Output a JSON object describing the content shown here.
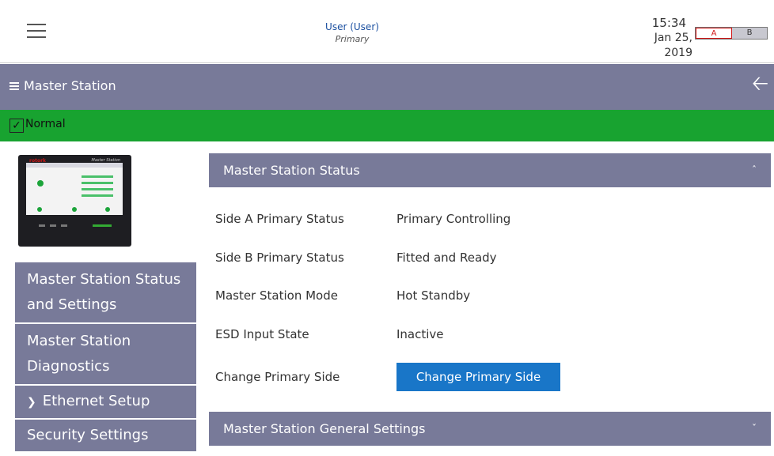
{
  "header": {
    "user_name": "User (User)",
    "user_role": "Primary",
    "time": "15:34",
    "date": "Jan 25, 2019",
    "side_a": "A",
    "side_b": "B"
  },
  "titlebar": {
    "title": "Master Station",
    "back_icon": "back-arrow-icon"
  },
  "status": {
    "checked": true,
    "label": "Normal",
    "color": "#18a330"
  },
  "device": {
    "brand": "rotork",
    "title": "Master Station"
  },
  "sidebar": {
    "items": [
      {
        "label": "Master Station Status and Settings"
      },
      {
        "label": "Master Station Diagnostics"
      },
      {
        "label": "Ethernet Setup"
      },
      {
        "label": "Security Settings"
      }
    ]
  },
  "panels": {
    "status_title": "Master Station Status",
    "general_title": "Master Station General Settings"
  },
  "status_rows": [
    {
      "key": "Side A Primary Status",
      "value": "Primary Controlling"
    },
    {
      "key": "Side B Primary Status",
      "value": "Fitted and Ready"
    },
    {
      "key": "Master Station Mode",
      "value": "Hot Standby"
    },
    {
      "key": "ESD Input State",
      "value": "Inactive"
    }
  ],
  "change_primary": {
    "key": "Change Primary Side",
    "button_label": "Change Primary Side"
  },
  "colors": {
    "accent_bar": "#787a99",
    "button_blue": "#1976c8",
    "side_a_red": "#d01515"
  }
}
